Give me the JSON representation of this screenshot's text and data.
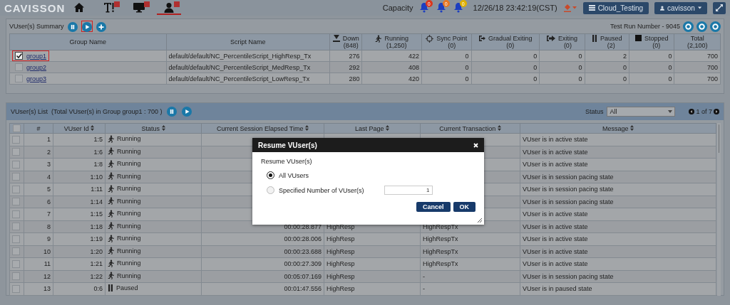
{
  "top_bar": {
    "logo": "CAVISSON",
    "tabs": [
      {
        "kind": "home",
        "selected": false,
        "closable": false
      },
      {
        "kind": "text",
        "selected": false,
        "closable": true
      },
      {
        "kind": "monitor",
        "selected": false,
        "closable": true
      },
      {
        "kind": "user",
        "selected": true,
        "closable": true
      }
    ],
    "capacity": "Capacity",
    "alerts": [
      {
        "count": "0",
        "color": "#d9381e"
      },
      {
        "count": "0",
        "color": "#e87722"
      },
      {
        "count": "0",
        "color": "#e0b000"
      }
    ],
    "datetime": "12/26/18 23:42:19(CST)",
    "project": "Cloud_Testing",
    "user": "cavisson"
  },
  "summary": {
    "title": "VUser(s) Summary",
    "actions": [
      {
        "kind": "pause",
        "highlighted": false
      },
      {
        "kind": "play",
        "highlighted": true
      },
      {
        "kind": "add",
        "highlighted": false
      }
    ],
    "test_run": "Test Run Number - 9045",
    "columns": [
      {
        "label": "Group Name"
      },
      {
        "label": "Script Name"
      },
      {
        "label": "Down",
        "sub": "(848)",
        "kind": "down"
      },
      {
        "label": "Running",
        "sub": "(1,250)",
        "kind": "run"
      },
      {
        "label": "Sync Point",
        "sub": "(0)",
        "kind": "sync"
      },
      {
        "label": "Gradual Exiting",
        "sub": "(0)",
        "kind": "gradual"
      },
      {
        "label": "Exiting",
        "sub": "(0)",
        "kind": "exit"
      },
      {
        "label": "Paused",
        "sub": "(2)",
        "kind": "pause"
      },
      {
        "label": "Stopped",
        "sub": "(0)",
        "kind": "stop"
      },
      {
        "label": "Total",
        "sub": "(2,100)"
      }
    ],
    "rows": [
      {
        "checked": true,
        "highlighted": true,
        "cells": [
          "group1",
          "default/default/NC_PercentileScript_HighResp_Tx",
          "276",
          "422",
          "0",
          "0",
          "0",
          "2",
          "0",
          "700"
        ]
      },
      {
        "checked": false,
        "highlighted": false,
        "cells": [
          "group2",
          "default/default/NC_PercentileScript_MedResp_Tx",
          "292",
          "408",
          "0",
          "0",
          "0",
          "0",
          "0",
          "700"
        ]
      },
      {
        "checked": false,
        "highlighted": false,
        "cells": [
          "group3",
          "default/default/NC_PercentileScript_LowResp_Tx",
          "280",
          "420",
          "0",
          "0",
          "0",
          "0",
          "0",
          "700"
        ]
      }
    ]
  },
  "list": {
    "title": "VUser(s) List",
    "subtitle": "(Total VUser(s) in Group group1 : 700 )",
    "all_checked": false,
    "status_label": "Status",
    "status_value": "All",
    "pager": "1 of 7",
    "columns": [
      "#",
      "VUser Id",
      "Status",
      "Current Session Elapsed Time",
      "Last Page",
      "Current Transaction",
      "Message"
    ],
    "rows": [
      {
        "checked": false,
        "num": "1",
        "id": "1:5",
        "kind": "running",
        "status": "Running",
        "message": "VUser is in active state"
      },
      {
        "checked": false,
        "num": "2",
        "id": "1:6",
        "kind": "running",
        "status": "Running",
        "message": "VUser is in active state"
      },
      {
        "checked": false,
        "num": "3",
        "id": "1:8",
        "kind": "running",
        "status": "Running",
        "message": "VUser is in active state"
      },
      {
        "checked": false,
        "num": "4",
        "id": "1:10",
        "kind": "running",
        "status": "Running",
        "message": "VUser is in session pacing state"
      },
      {
        "checked": false,
        "num": "5",
        "id": "1:11",
        "kind": "running",
        "status": "Running",
        "message": "VUser is in session pacing state"
      },
      {
        "checked": false,
        "num": "6",
        "id": "1:14",
        "kind": "running",
        "status": "Running",
        "message": "VUser is in session pacing state"
      },
      {
        "checked": false,
        "num": "7",
        "id": "1:15",
        "kind": "running",
        "status": "Running",
        "message": "VUser is in active state"
      },
      {
        "checked": false,
        "num": "8",
        "id": "1:18",
        "kind": "running",
        "status": "Running",
        "elapsed": "00:00:28.877",
        "page": "HighResp",
        "txn": "HighRespTx",
        "message": "VUser is in active state"
      },
      {
        "checked": false,
        "num": "9",
        "id": "1:19",
        "kind": "running",
        "status": "Running",
        "elapsed": "00:00:28.006",
        "page": "HighResp",
        "txn": "HighRespTx",
        "message": "VUser is in active state"
      },
      {
        "checked": false,
        "num": "10",
        "id": "1:20",
        "kind": "running",
        "status": "Running",
        "elapsed": "00:00:23.688",
        "page": "HighResp",
        "txn": "HighRespTx",
        "message": "VUser is in active state"
      },
      {
        "checked": false,
        "num": "11",
        "id": "1:21",
        "kind": "running",
        "status": "Running",
        "elapsed": "00:00:27.309",
        "page": "HighResp",
        "txn": "HighRespTx",
        "message": "VUser is in active state"
      },
      {
        "checked": false,
        "num": "12",
        "id": "1:22",
        "kind": "running",
        "status": "Running",
        "elapsed": "00:05:07.169",
        "page": "HighResp",
        "txn": "-",
        "message": "VUser is in session pacing state"
      },
      {
        "checked": false,
        "num": "13",
        "id": "0:6",
        "kind": "paused",
        "status": "Paused",
        "elapsed": "00:01:47.556",
        "page": "HighResp",
        "txn": "-",
        "message": "VUser is in paused state"
      }
    ]
  },
  "dialog": {
    "title": "Resume VUser(s)",
    "prompt": "Resume VUser(s)",
    "options": [
      {
        "label": "All VUsers",
        "selected": true
      },
      {
        "label": "Specified Number of VUser(s)",
        "selected": false
      }
    ],
    "count": "1",
    "buttons": [
      "Cancel",
      "OK"
    ]
  }
}
